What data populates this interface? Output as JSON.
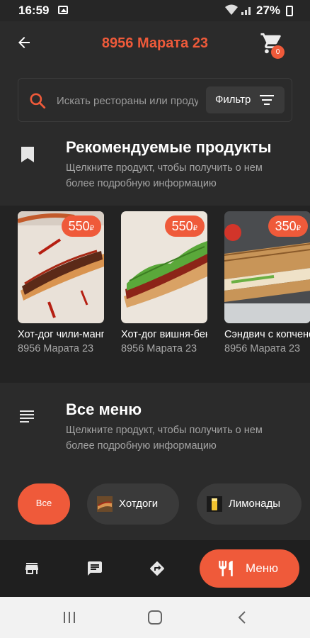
{
  "status_bar": {
    "time": "16:59",
    "battery": "27%"
  },
  "header": {
    "title": "8956 Марата 23",
    "cart_count": "0"
  },
  "search": {
    "placeholder": "Искать рестораны или продукты",
    "filter_label": "Фильтр"
  },
  "featured": {
    "title": "Рекомендуемые продукты",
    "subtitle": "Щелкните продукт, чтобы получить о нем более подробную информацию",
    "products": [
      {
        "name": "Хот-дог чили-манго",
        "restaurant": "8956 Марата 23",
        "price": "550",
        "currency": "₽"
      },
      {
        "name": "Хот-дог вишня-бекон",
        "restaurant": "8956 Марата 23",
        "price": "550",
        "currency": "₽"
      },
      {
        "name": "Сэндвич с копченой курицей",
        "restaurant": "8956 Марата 23",
        "price": "350",
        "currency": "₽"
      }
    ]
  },
  "menu": {
    "title": "Все меню",
    "subtitle": "Щелкните продукт, чтобы получить о нем более подробную информацию",
    "categories": [
      {
        "label": "Все"
      },
      {
        "label": "Хотдоги"
      },
      {
        "label": "Лимонады"
      }
    ]
  },
  "bottom_nav": {
    "items": [
      {
        "icon": "store-icon"
      },
      {
        "icon": "chat-icon"
      },
      {
        "icon": "directions-icon"
      },
      {
        "icon": "restaurant-icon",
        "label": "Меню"
      }
    ]
  },
  "colors": {
    "accent": "#ef5a3a",
    "background": "#2b2b2b",
    "card_strip": "#232323"
  }
}
